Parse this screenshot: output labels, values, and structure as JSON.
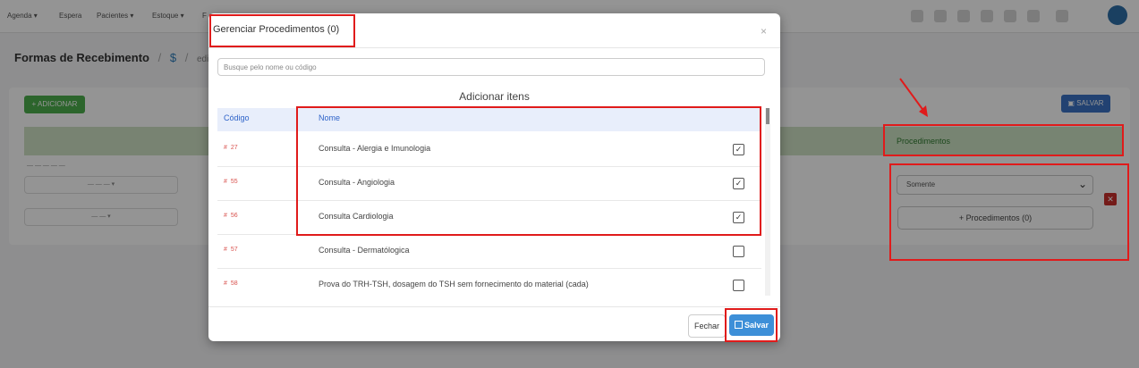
{
  "navbar": {
    "items": [
      "Agenda ▾",
      "Espera",
      "Pacientes ▾",
      "Estoque ▾",
      "F"
    ]
  },
  "breadcrumb": {
    "title": "Formas de Recebimento",
    "sep": "/",
    "link": "$",
    "crumb": "edição d"
  },
  "background": {
    "add_button": "+ ADICIONAR",
    "save_button": "SALVAR",
    "procedures_header": "Procedimentos",
    "select_value": "Somente",
    "procedures_button": "+ Procedimentos (0)"
  },
  "modal": {
    "title": "Gerenciar Procedimentos (0)",
    "close": "×",
    "search_placeholder": "Busque pelo nome ou código",
    "add_items": "Adicionar itens",
    "columns": {
      "code": "Código",
      "name": "Nome"
    },
    "rows": [
      {
        "code": "27",
        "name": "Consulta - Alergia e Imunologia",
        "checked": true
      },
      {
        "code": "55",
        "name": "Consulta - Angiologia",
        "checked": true
      },
      {
        "code": "56",
        "name": "Consulta Cardiologia",
        "checked": true
      },
      {
        "code": "57",
        "name": "Consulta - Dermatólogica",
        "checked": false
      },
      {
        "code": "58",
        "name": "Prova do TRH-TSH, dosagem do TSH sem fornecimento do material (cada)",
        "checked": false
      }
    ],
    "cancel_button": "Fechar",
    "save_button": "Salvar"
  },
  "colors": {
    "annotation": "#e01b1b",
    "primary": "#3d8fd8",
    "success": "#4cae4c",
    "danger": "#d9534f"
  }
}
